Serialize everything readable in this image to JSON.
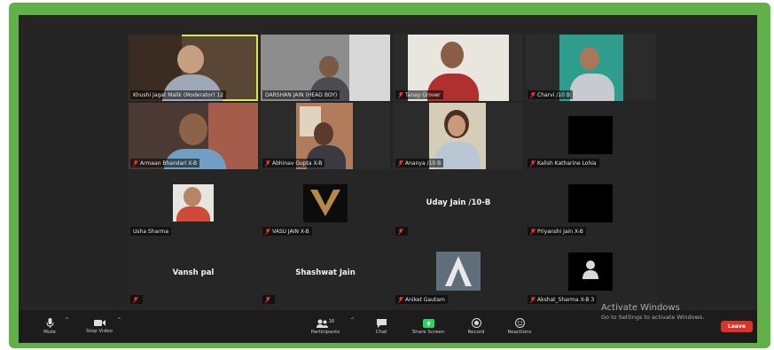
{
  "tiles": [
    {
      "name": "Khushi Jagat Malik (Moderator) 12",
      "id": "t1"
    },
    {
      "name": "DARSHAN JAIN (HEAD BOY)",
      "id": "t2"
    },
    {
      "name": "Tanay Grover",
      "id": "t3"
    },
    {
      "name": "Charvi /10 B",
      "id": "t4"
    },
    {
      "name": "Armaan Bhandari X-B",
      "id": "t5"
    },
    {
      "name": "Abhinav Gupta X-B",
      "id": "t6"
    },
    {
      "name": "Ananya /10 B",
      "id": "t7"
    },
    {
      "name": "Kalish Katharine Lohia",
      "id": "t8"
    },
    {
      "name": "Usha Sharma",
      "id": "t9"
    },
    {
      "name": "VASU JAIN X-B",
      "id": "t10"
    },
    {
      "name": "",
      "id": "t11",
      "center_name": "Uday Jain /10-B"
    },
    {
      "name": "Priyanshi Jain X-B",
      "id": "t12"
    },
    {
      "name": "",
      "id": "t13",
      "center_name": "Vansh pal"
    },
    {
      "name": "",
      "id": "t14",
      "center_name": "Shashwat Jain"
    },
    {
      "name": "Aniket Gautam",
      "id": "t15"
    },
    {
      "name": "Akshat_Sharma X-B 3",
      "id": "t16"
    }
  ],
  "toolbar": {
    "mute": "Mute",
    "stop_video": "Stop Video",
    "participants": "Participants",
    "participants_count": "16",
    "chat": "Chat",
    "share_screen": "Share Screen",
    "record": "Record",
    "reactions": "Reactions",
    "leave": "Leave"
  },
  "watermark": {
    "title": "Activate Windows",
    "subtitle": "Go to Settings to activate Windows."
  },
  "colors": {
    "frame_green": "#62b048",
    "background": "#252525",
    "active_speaker": "#d7e94b",
    "leave_red": "#d9342b",
    "share_green": "#23d959"
  }
}
